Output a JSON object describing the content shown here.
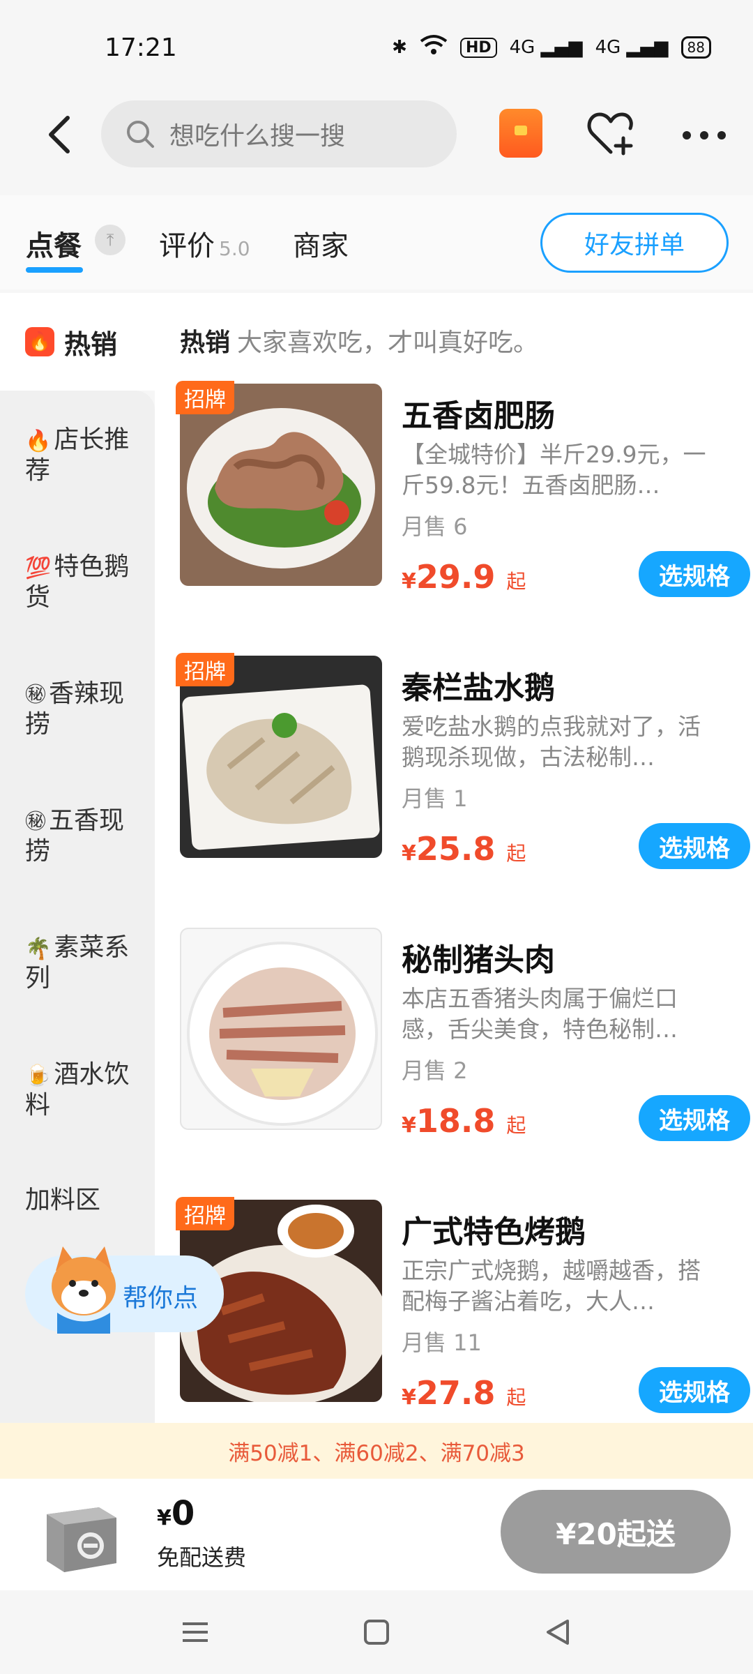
{
  "status_bar": {
    "time": "17:21",
    "hd": "HD",
    "net1": "4G",
    "net2": "4G",
    "battery": "88"
  },
  "search": {
    "placeholder": "想吃什么搜一搜"
  },
  "tabs": [
    {
      "label": "点餐"
    },
    {
      "label": "评价",
      "rating": "5.0"
    },
    {
      "label": "商家"
    }
  ],
  "group_order_button": "好友拼单",
  "sidebar": {
    "hot_label": "热销",
    "items": [
      {
        "emoji": "🔥",
        "label": "店长推荐"
      },
      {
        "emoji": "💯",
        "label": "特色鹅货"
      },
      {
        "emoji": "㊙",
        "label": "香辣现捞"
      },
      {
        "emoji": "㊙",
        "label": "五香现捞"
      },
      {
        "emoji": "🌴",
        "label": "素菜系列"
      },
      {
        "emoji": "🍺",
        "label": "酒水饮料"
      },
      {
        "emoji": "",
        "label": "加料区"
      }
    ]
  },
  "section": {
    "title": "热销",
    "subtitle": "大家喜欢吃，才叫真好吃。"
  },
  "badge_label": "招牌",
  "spec_button_label": "选规格",
  "price_suffix": "起",
  "currency": "¥",
  "products": [
    {
      "name": "五香卤肥肠",
      "desc": "【全城特价】半斤29.9元，一斤59.8元！五香卤肥肠…",
      "sales": "月售 6",
      "price": "29.9",
      "badge": true
    },
    {
      "name": "秦栏盐水鹅",
      "desc": "爱吃盐水鹅的点我就对了，活鹅现杀现做，古法秘制…",
      "sales": "月售 1",
      "price": "25.8",
      "badge": true
    },
    {
      "name": "秘制猪头肉",
      "desc": "本店五香猪头肉属于偏烂口感，舌尖美食，特色秘制…",
      "sales": "月售 2",
      "price": "18.8",
      "badge": false
    },
    {
      "name": "广式特色烤鹅",
      "desc": "正宗广式烧鹅，越嚼越香，搭配梅子酱沾着吃，大人…",
      "sales": "月售 11",
      "price": "27.8",
      "badge": true
    }
  ],
  "helper": {
    "label": "帮你点"
  },
  "promo": {
    "text": "满50减1、满60减2、满70减3"
  },
  "cart": {
    "total": "0",
    "fee_text": "免配送费",
    "checkout_label": "¥20起送"
  },
  "colors": {
    "accent": "#16a7ff",
    "price": "#f04b2b",
    "badge": "#ff6a1a"
  }
}
